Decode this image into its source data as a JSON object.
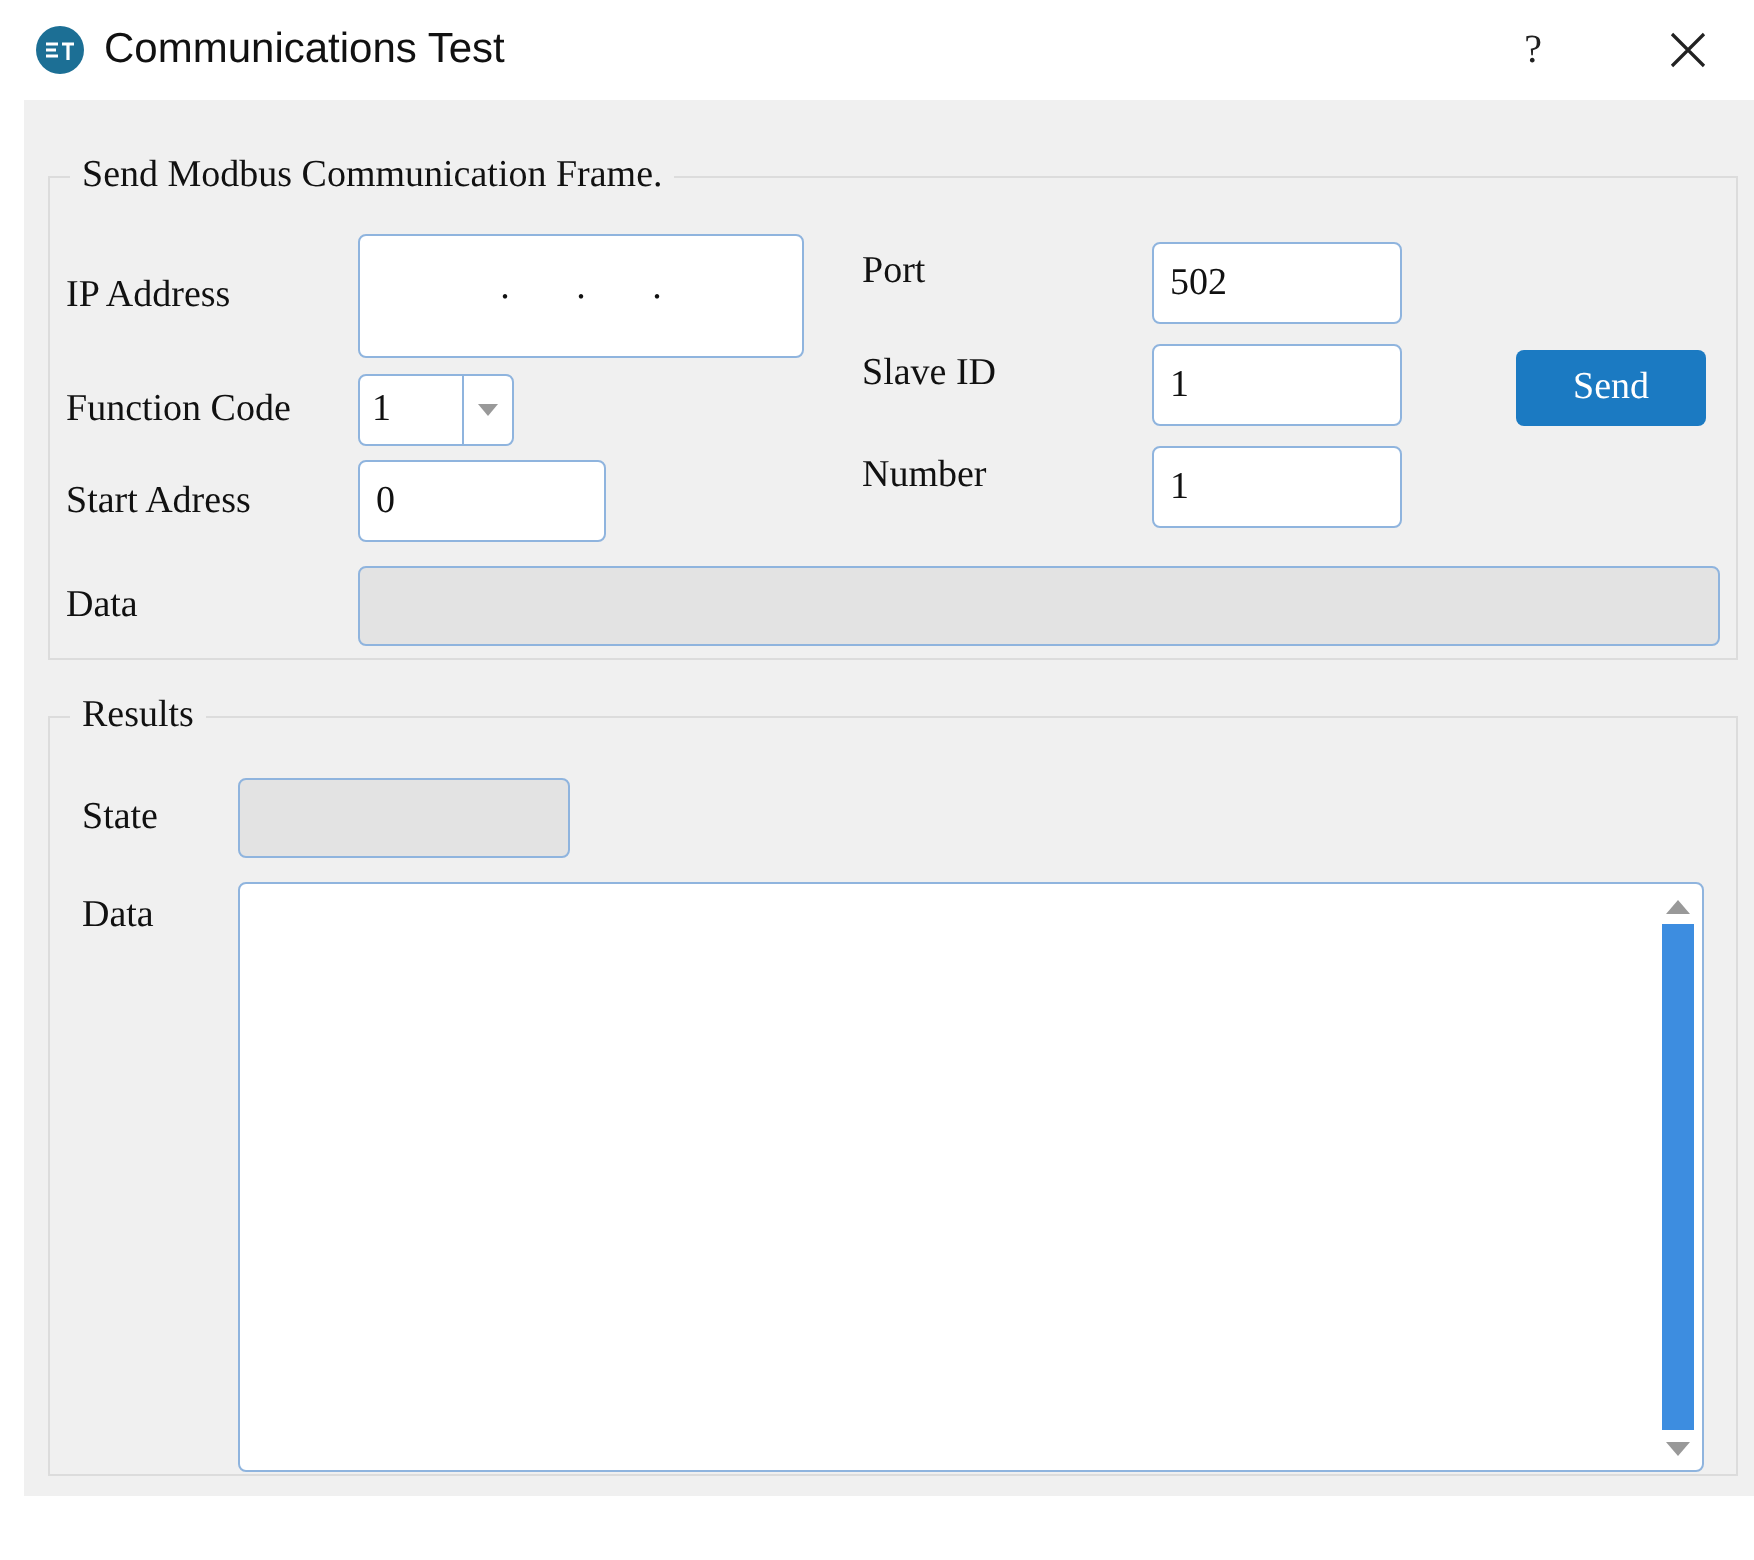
{
  "window": {
    "title": "Communications Test",
    "help": "?"
  },
  "send_group": {
    "title": "Send Modbus Communication Frame.",
    "left_fields": [
      {
        "kind": "ip",
        "label": "IP Address",
        "value": ".       .       .",
        "disabled": false
      },
      {
        "kind": "combo",
        "label": "Function Code",
        "value": "1",
        "disabled": false
      },
      {
        "kind": "text",
        "label": "Start Adress",
        "value": "0",
        "disabled": false
      }
    ],
    "right_fields": [
      {
        "kind": "text",
        "label": "Port",
        "value": "502",
        "disabled": false
      },
      {
        "kind": "text",
        "label": "Slave ID",
        "value": "1",
        "disabled": false
      },
      {
        "kind": "text",
        "label": "Number",
        "value": "1",
        "disabled": false
      }
    ],
    "send_button": "Send",
    "data": {
      "label": "Data",
      "disabled": true
    }
  },
  "results_group": {
    "title": "Results",
    "state": {
      "label": "State",
      "disabled": true
    },
    "data": {
      "label": "Data",
      "disabled": false
    }
  }
}
